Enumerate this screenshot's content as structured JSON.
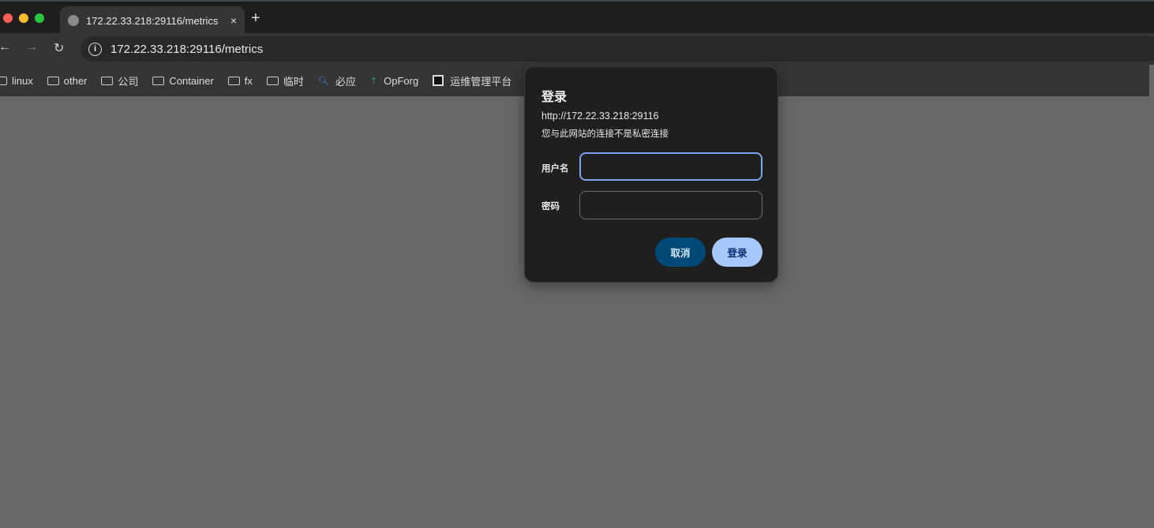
{
  "tab": {
    "title": "172.22.33.218:29116/metrics",
    "close": "×",
    "new_tab": "+"
  },
  "toolbar": {
    "back": "←",
    "forward": "→",
    "reload": "↻",
    "info": "i",
    "url": "172.22.33.218:29116/metrics"
  },
  "bookmarks": [
    {
      "label": "linux",
      "icon": "folder-icon"
    },
    {
      "label": "other",
      "icon": "folder-icon"
    },
    {
      "label": "公司",
      "icon": "folder-icon"
    },
    {
      "label": "Container",
      "icon": "folder-icon"
    },
    {
      "label": "fx",
      "icon": "folder-icon"
    },
    {
      "label": "临时",
      "icon": "folder-icon"
    },
    {
      "label": "必应",
      "icon": "search-icon"
    },
    {
      "label": "OpForg",
      "icon": "opforg-icon"
    },
    {
      "label": "运维管理平台",
      "icon": "app-icon"
    }
  ],
  "dialog": {
    "title": "登录",
    "origin": "http://172.22.33.218:29116",
    "warning": "您与此网站的连接不是私密连接",
    "username_label": "用户名",
    "username_value": "",
    "password_label": "密码",
    "password_value": "",
    "cancel": "取消",
    "submit": "登录"
  },
  "colors": {
    "accent": "#7ba4ee",
    "cancel_bg": "#004a77",
    "submit_bg": "#a8c7fa"
  }
}
